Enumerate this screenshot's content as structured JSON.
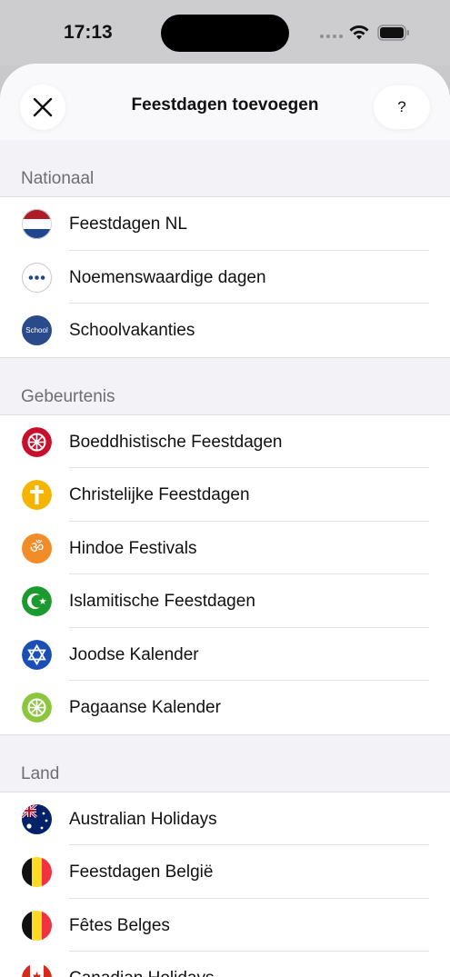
{
  "status_bar": {
    "time": "17:13"
  },
  "header": {
    "title": "Feestdagen toevoegen",
    "help_label": "?"
  },
  "sections": [
    {
      "title": "Nationaal",
      "items": [
        {
          "label": "Feestdagen NL",
          "icon": "netherlands-flag-icon"
        },
        {
          "label": "Noemenswaardige dagen",
          "icon": "dots-icon"
        },
        {
          "label": "Schoolvakanties",
          "icon": "school-icon",
          "icon_text": "School"
        }
      ]
    },
    {
      "title": "Gebeurtenis",
      "items": [
        {
          "label": "Boeddhistische Feestdagen",
          "icon": "dharma-wheel-icon"
        },
        {
          "label": "Christelijke Feestdagen",
          "icon": "cross-icon"
        },
        {
          "label": "Hindoe Festivals",
          "icon": "om-icon"
        },
        {
          "label": "Islamitische Feestdagen",
          "icon": "crescent-star-icon"
        },
        {
          "label": "Joodse Kalender",
          "icon": "star-of-david-icon"
        },
        {
          "label": "Pagaanse Kalender",
          "icon": "pagan-wheel-icon"
        }
      ]
    },
    {
      "title": "Land",
      "items": [
        {
          "label": "Australian Holidays",
          "icon": "australia-flag-icon"
        },
        {
          "label": "Feestdagen België",
          "icon": "belgium-flag-icon"
        },
        {
          "label": "Fêtes Belges",
          "icon": "belgium-flag-icon"
        },
        {
          "label": "Canadian Holidays",
          "icon": "canada-flag-icon"
        }
      ]
    }
  ],
  "colors": {
    "buddhist": "#c8102e",
    "christian": "#f5b400",
    "hindu": "#f28c28",
    "islamic": "#1a9a2f",
    "jewish": "#1c4fb5",
    "pagan": "#8cc63f",
    "school": "#2b4a8b"
  }
}
